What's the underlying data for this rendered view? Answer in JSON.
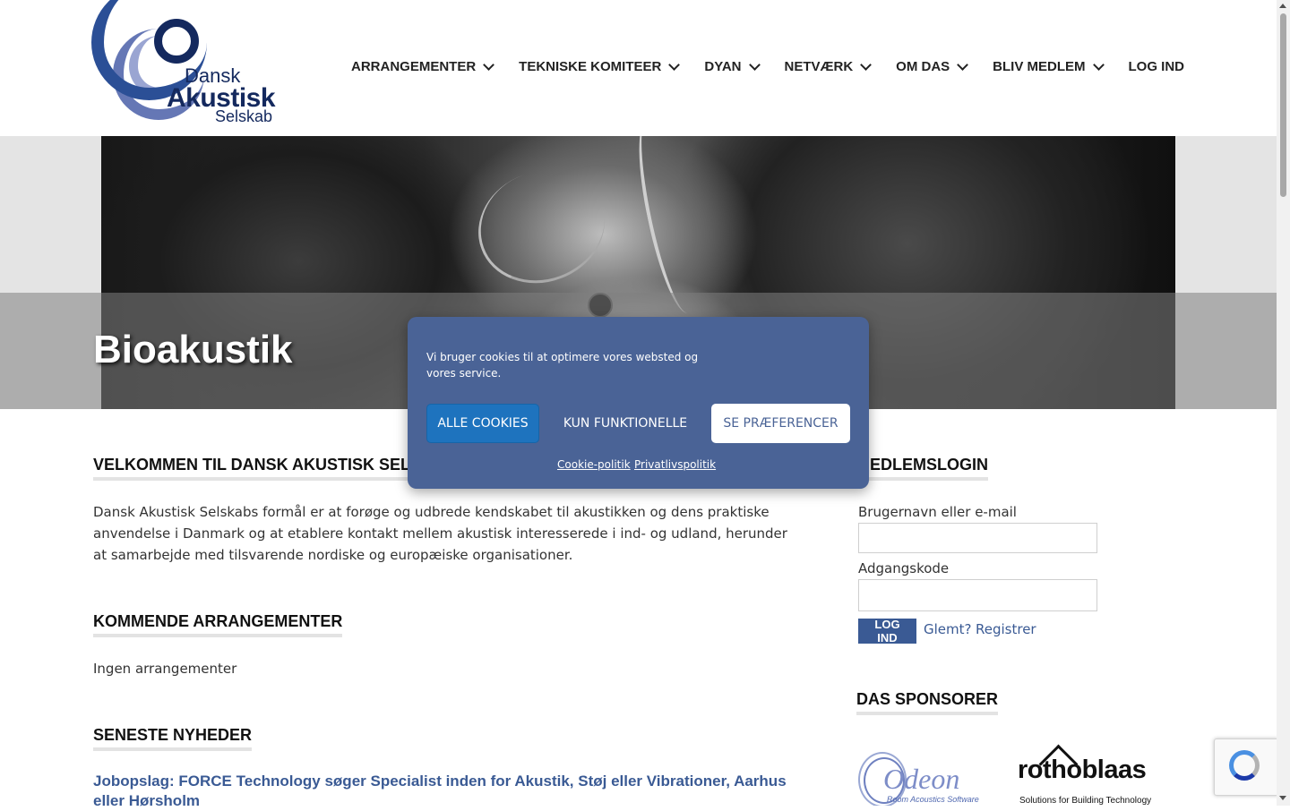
{
  "logo": {
    "line1": "Dansk",
    "line2": "Akustisk",
    "line3": "Selskab"
  },
  "nav": [
    {
      "label": "ARRANGEMENTER",
      "dropdown": true
    },
    {
      "label": "TEKNISKE KOMITEER",
      "dropdown": true
    },
    {
      "label": "DYAN",
      "dropdown": true
    },
    {
      "label": "NETVÆRK",
      "dropdown": true
    },
    {
      "label": "OM DAS",
      "dropdown": true
    },
    {
      "label": "BLIV MEDLEM",
      "dropdown": true
    },
    {
      "label": "LOG IND",
      "dropdown": false
    }
  ],
  "hero": {
    "title": "Bioakustik"
  },
  "welcome": {
    "title": "VELKOMMEN TIL DANSK AKUSTISK SELSKAB",
    "text": "Dansk Akustisk Selskabs formål er at forøge og udbrede kendskabet til akustikken og dens praktiske anvendelse i Danmark og at etablere kontakt mellem akustisk interesserede i ind- og udland, herunder at samarbejde med tilsvarende nordiske og europæiske organisationer."
  },
  "events": {
    "title": "KOMMENDE ARRANGEMENTER",
    "empty_text": "Ingen arrangementer"
  },
  "news": {
    "title": "SENESTE NYHEDER",
    "items": [
      "Jobopslag: FORCE Technology søger Specialist inden for Akustik, Støj eller Vibrationer, Aarhus eller Hørsholm"
    ]
  },
  "login": {
    "title": "MEDLEMSLOGIN",
    "username_label": "Brugernavn eller e-mail",
    "username_value": "",
    "password_label": "Adgangskode",
    "password_value": "",
    "submit_label": "LOG IND",
    "forgot_label": "Glemt?",
    "register_label": "Registrer"
  },
  "sponsors": {
    "title": "DAS SPONSORER",
    "items": [
      {
        "name": "Odeon",
        "subtitle": "Room Acoustics Software"
      },
      {
        "name": "rothoblaas",
        "subtitle": "Solutions for Building Technology"
      }
    ]
  },
  "cookie": {
    "text": "Vi bruger cookies til at optimere vores websted og vores service.",
    "accept_all": "ALLE COOKIES",
    "functional_only": "KUN FUNKTIONELLE",
    "preferences": "SE PRÆFERENCER",
    "cookie_policy": "Cookie-politik",
    "privacy_policy": "Privatlivspolitik"
  },
  "colors": {
    "primary": "#3a5a94",
    "cookie_bg": "#4a6396",
    "accept_btn": "#1e73be",
    "logo_dark": "#14295e"
  }
}
